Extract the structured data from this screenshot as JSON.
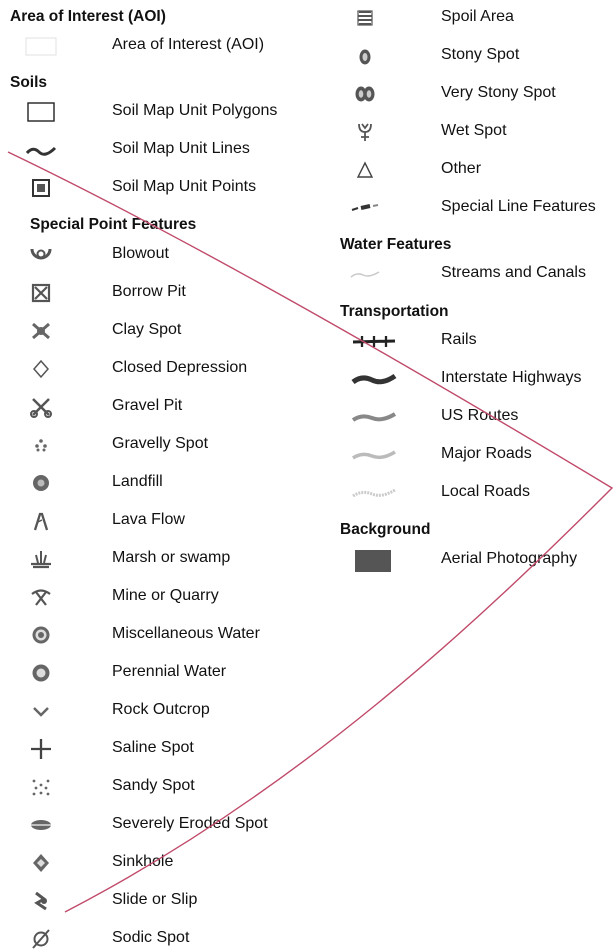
{
  "colors": {
    "text": "#111111",
    "symbol": "#555555",
    "overlay_line": "#c04a6a"
  },
  "left": {
    "aoi": {
      "heading": "Area of Interest (AOI)",
      "items": [
        {
          "label": "Area of Interest (AOI)",
          "icon": "aoi-outline-icon"
        }
      ]
    },
    "soils": {
      "heading": "Soils",
      "items": [
        {
          "label": "Soil Map Unit Polygons",
          "icon": "polygon-box-icon"
        },
        {
          "label": "Soil Map Unit Lines",
          "icon": "wavy-line-icon"
        },
        {
          "label": "Soil Map Unit Points",
          "icon": "point-square-icon"
        }
      ]
    },
    "special_points": {
      "heading": "Special Point Features",
      "items": [
        {
          "label": "Blowout",
          "icon": "blowout-icon"
        },
        {
          "label": "Borrow Pit",
          "icon": "borrow-pit-icon"
        },
        {
          "label": "Clay Spot",
          "icon": "clay-spot-icon"
        },
        {
          "label": "Closed Depression",
          "icon": "closed-depression-icon"
        },
        {
          "label": "Gravel Pit",
          "icon": "gravel-pit-icon"
        },
        {
          "label": "Gravelly Spot",
          "icon": "gravelly-spot-icon"
        },
        {
          "label": "Landfill",
          "icon": "landfill-icon"
        },
        {
          "label": "Lava Flow",
          "icon": "lava-flow-icon"
        },
        {
          "label": "Marsh or swamp",
          "icon": "marsh-icon"
        },
        {
          "label": "Mine or Quarry",
          "icon": "mine-icon"
        },
        {
          "label": "Miscellaneous Water",
          "icon": "misc-water-icon"
        },
        {
          "label": "Perennial Water",
          "icon": "perennial-water-icon"
        },
        {
          "label": "Rock Outcrop",
          "icon": "rock-outcrop-icon"
        },
        {
          "label": "Saline Spot",
          "icon": "saline-spot-icon"
        },
        {
          "label": "Sandy Spot",
          "icon": "sandy-spot-icon"
        },
        {
          "label": "Severely Eroded Spot",
          "icon": "eroded-spot-icon"
        },
        {
          "label": "Sinkhole",
          "icon": "sinkhole-icon"
        },
        {
          "label": "Slide or Slip",
          "icon": "slide-icon"
        },
        {
          "label": "Sodic Spot",
          "icon": "sodic-spot-icon"
        }
      ]
    }
  },
  "right": {
    "special_points_cont": [
      {
        "label": "Spoil Area",
        "icon": "spoil-area-icon"
      },
      {
        "label": "Stony Spot",
        "icon": "stony-spot-icon"
      },
      {
        "label": "Very Stony Spot",
        "icon": "very-stony-spot-icon"
      },
      {
        "label": "Wet Spot",
        "icon": "wet-spot-icon"
      },
      {
        "label": "Other",
        "icon": "triangle-icon"
      },
      {
        "label": "Special Line Features",
        "icon": "special-line-icon"
      }
    ],
    "water": {
      "heading": "Water Features",
      "items": [
        {
          "label": "Streams and Canals",
          "icon": "stream-line-icon"
        }
      ]
    },
    "transportation": {
      "heading": "Transportation",
      "items": [
        {
          "label": "Rails",
          "icon": "rails-icon"
        },
        {
          "label": "Interstate Highways",
          "icon": "interstate-icon"
        },
        {
          "label": "US Routes",
          "icon": "us-route-icon"
        },
        {
          "label": "Major Roads",
          "icon": "major-road-icon"
        },
        {
          "label": "Local Roads",
          "icon": "local-road-icon"
        }
      ]
    },
    "background": {
      "heading": "Background",
      "items": [
        {
          "label": "Aerial Photography",
          "icon": "aerial-photo-icon"
        }
      ]
    }
  }
}
